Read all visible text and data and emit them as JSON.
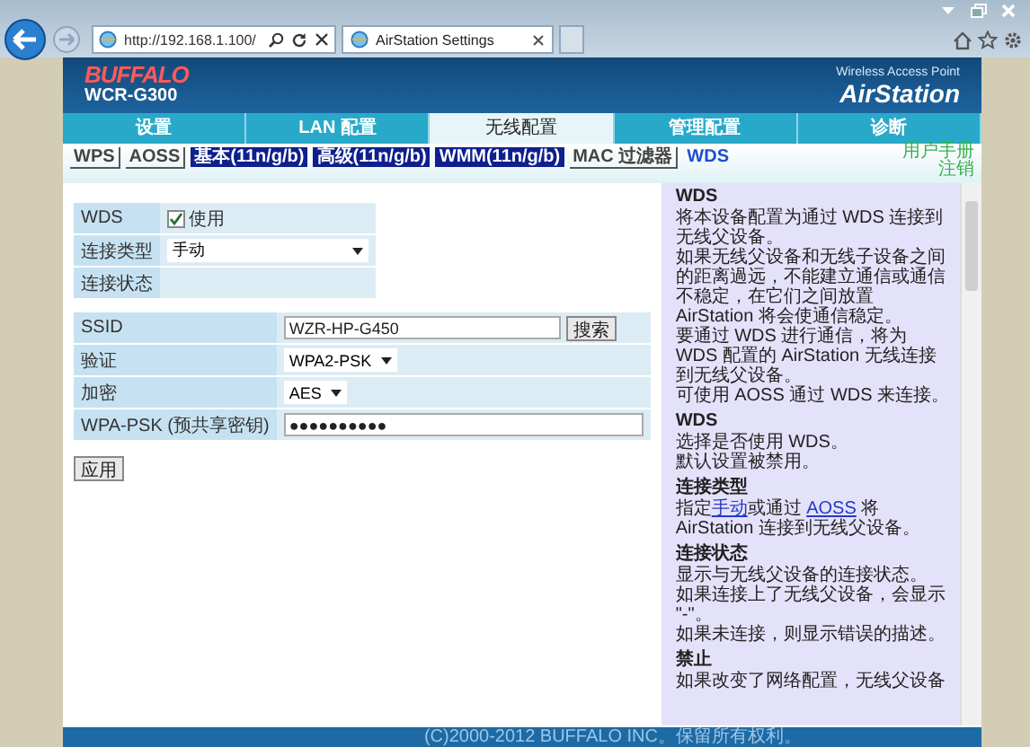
{
  "browser": {
    "address": "http://192.168.1.100/",
    "tabs": [
      {
        "label": "AirStation Settings",
        "selected": true
      }
    ]
  },
  "header": {
    "logo": "BUFFALO",
    "model": "WCR-G300",
    "subtitle": "Wireless Access Point",
    "product": "AirStation"
  },
  "main_tabs": [
    {
      "label": "设置",
      "selected": false
    },
    {
      "label": "LAN 配置",
      "selected": false
    },
    {
      "label": "无线配置",
      "selected": true
    },
    {
      "label": "管理配置",
      "selected": false
    },
    {
      "label": "诊断",
      "selected": false
    }
  ],
  "sub_tabs": [
    {
      "label": "WPS",
      "kind": "plain",
      "selected": false
    },
    {
      "label": "AOSS",
      "kind": "plain",
      "selected": false
    },
    {
      "label": "基本(11n/g/b)",
      "kind": "highlight",
      "selected": false
    },
    {
      "label": "高级(11n/g/b)",
      "kind": "highlight",
      "selected": false
    },
    {
      "label": "WMM(11n/g/b)",
      "kind": "highlight",
      "selected": false
    },
    {
      "label": "MAC 过滤器",
      "kind": "plain",
      "selected": false
    },
    {
      "label": "WDS",
      "kind": "plain",
      "selected": true
    }
  ],
  "links": [
    "用户手册",
    "注销"
  ],
  "wds_table": [
    {
      "label": "WDS",
      "kind": "checkbox",
      "text": "使用",
      "checked": true
    },
    {
      "label": "连接类型",
      "kind": "select",
      "value": "手动"
    },
    {
      "label": "连接状态",
      "kind": "empty"
    }
  ],
  "security_table": [
    {
      "label": "SSID",
      "kind": "text",
      "value": "WZR-HP-G450",
      "button": "搜索"
    },
    {
      "label": "验证",
      "kind": "select",
      "value": "WPA2-PSK"
    },
    {
      "label": "加密",
      "kind": "select",
      "value": "AES"
    },
    {
      "label": "WPA-PSK (预共享密钥)",
      "kind": "password",
      "value": "●●●●●●●●●●"
    }
  ],
  "apply_button": "应用",
  "help": [
    {
      "heading": "WDS",
      "lines": [
        [
          {
            "text": "将本设备配置为通过 WDS 连接到无线父设备。"
          }
        ],
        [
          {
            "text": "如果无线父设备和无线子设备之间的距离過远，不能建立通信或通信不稳定，在它们之间放置 AirStation 将会使通信稳定。"
          }
        ],
        [
          {
            "text": "要通过 WDS 进行通信，将为 WDS 配置的 AirStation 无线连接到无线父设备。"
          }
        ],
        [
          {
            "text": "可使用 AOSS 通过 WDS 来连接。"
          }
        ]
      ]
    },
    {
      "heading": "WDS",
      "lines": [
        [
          {
            "text": "选择是否使用 WDS。"
          }
        ],
        [
          {
            "text": "默认设置被禁用。"
          }
        ]
      ]
    },
    {
      "heading": "连接类型",
      "lines": [
        [
          {
            "text": "指定"
          },
          {
            "text": "手动",
            "link": true
          },
          {
            "text": "或通过 "
          },
          {
            "text": "AOSS",
            "link": true
          },
          {
            "text": " 将 AirStation 连接到无线父设备。"
          }
        ]
      ]
    },
    {
      "heading": "连接状态",
      "lines": [
        [
          {
            "text": "显示与无线父设备的连接状态。"
          }
        ],
        [
          {
            "text": "如果连接上了无线父设备，会显示 \"-\"。"
          }
        ],
        [
          {
            "text": "如果未连接，则显示错误的描述。"
          }
        ]
      ]
    },
    {
      "heading": "禁止",
      "lines": [
        [
          {
            "text": "如果改变了网络配置，无线父设备"
          }
        ]
      ]
    }
  ],
  "footer": "(C)2000-2012 BUFFALO INC。保留所有权利。"
}
